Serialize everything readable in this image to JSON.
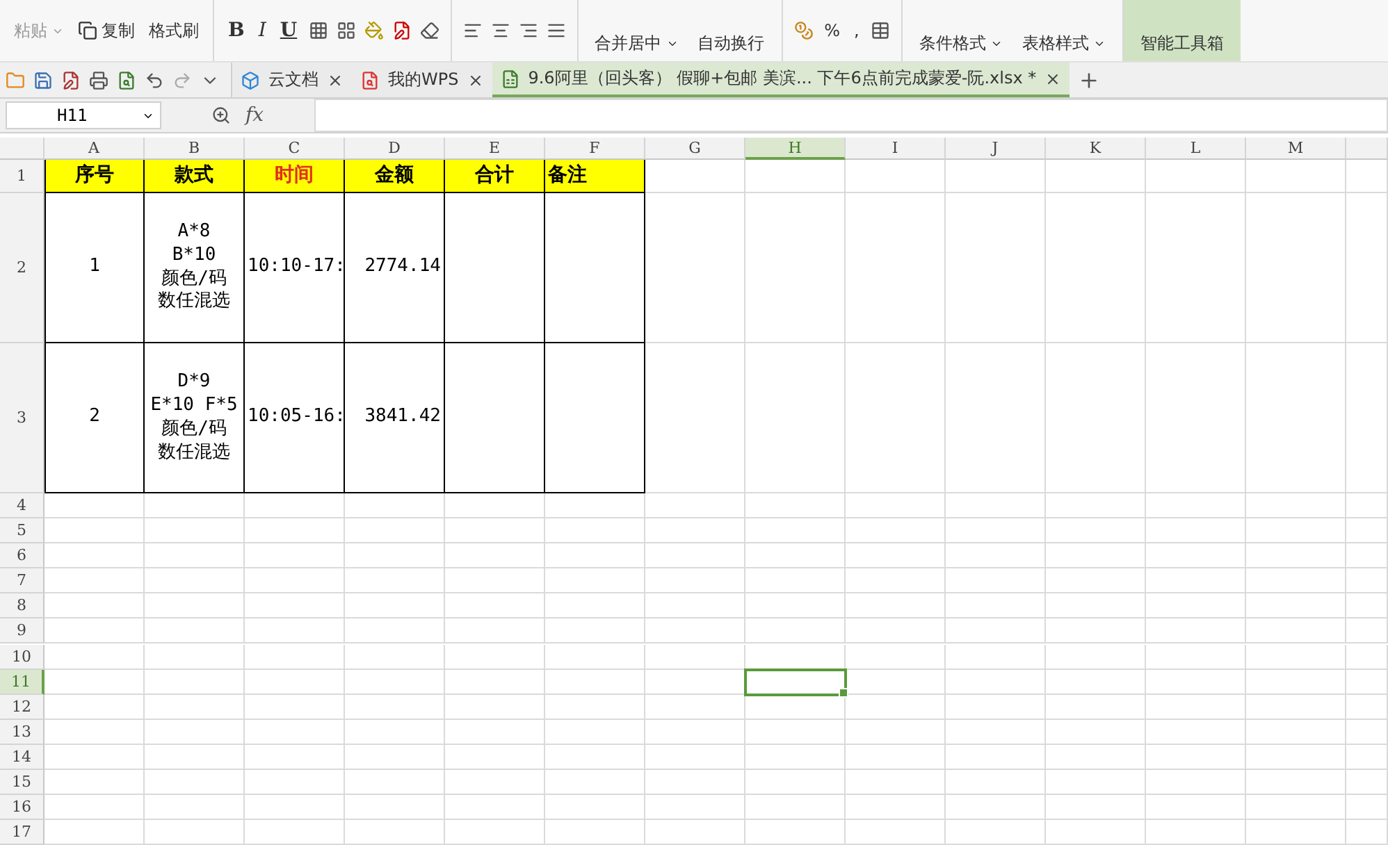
{
  "ribbon": {
    "groups": [
      {
        "kind": "clipboard",
        "labels": [
          "粘贴",
          "复制",
          "格式刷"
        ]
      },
      {
        "kind": "font",
        "labels": [
          "B",
          "I",
          "U"
        ]
      },
      {
        "kind": "align"
      },
      {
        "kind": "merge",
        "labels": [
          "合并居中",
          "自动换行"
        ]
      },
      {
        "kind": "number",
        "labels": [
          "%",
          ","
        ]
      },
      {
        "kind": "styles",
        "labels": [
          "条件格式",
          "表格样式"
        ]
      },
      {
        "kind": "tools",
        "labels": [
          "智能工具箱"
        ]
      }
    ]
  },
  "tabs": [
    {
      "kind": "cloud",
      "label": "云文档",
      "selected": false
    },
    {
      "kind": "wps",
      "label": "我的WPS",
      "selected": false
    },
    {
      "kind": "sheet",
      "label": "9.6阿里（回头客） 假聊+包邮 美滨... 下午6点前完成蒙爱-阮.xlsx *",
      "selected": true
    }
  ],
  "formula_bar": {
    "name_box": "H11",
    "fx": "fx"
  },
  "columns": [
    {
      "label": "A",
      "selected": false
    },
    {
      "label": "B",
      "selected": false
    },
    {
      "label": "C",
      "selected": false
    },
    {
      "label": "D",
      "selected": false
    },
    {
      "label": "E",
      "selected": false
    },
    {
      "label": "F",
      "selected": false
    },
    {
      "label": "G",
      "selected": false
    },
    {
      "label": "H",
      "selected": true
    },
    {
      "label": "I",
      "selected": false
    },
    {
      "label": "J",
      "selected": false
    },
    {
      "label": "K",
      "selected": false
    },
    {
      "label": "L",
      "selected": false
    },
    {
      "label": "M",
      "selected": false
    }
  ],
  "rows": [
    {
      "number": "1",
      "kind": "header",
      "selected": false,
      "cells": [
        {
          "text": "序号",
          "color": "#000000",
          "kind": "center"
        },
        {
          "text": "款式",
          "color": "#000000",
          "kind": "center"
        },
        {
          "text": "时间",
          "color": "#e0301e",
          "kind": "center"
        },
        {
          "text": "金额",
          "color": "#000000",
          "kind": "center"
        },
        {
          "text": "合计",
          "color": "#000000",
          "kind": "center"
        },
        {
          "text": "备注",
          "color": "#000000",
          "kind": "left"
        }
      ]
    },
    {
      "number": "2",
      "kind": "data",
      "selected": false,
      "cells": [
        {
          "text": "1",
          "kind": "center"
        },
        {
          "text": "A*8\nB*10\n颜色/码数任混选",
          "kind": "center"
        },
        {
          "text": "10:10-17:",
          "kind": "left"
        },
        {
          "text": "2774.14",
          "kind": "right"
        },
        {
          "kind": "empty"
        },
        {
          "kind": "empty"
        }
      ]
    },
    {
      "number": "3",
      "kind": "data",
      "selected": false,
      "cells": [
        {
          "text": "2",
          "kind": "center"
        },
        {
          "text": "D*9\nE*10 F*5\n颜色/码数任混选",
          "kind": "center"
        },
        {
          "text": "10:05-16:",
          "kind": "left"
        },
        {
          "text": "3841.42",
          "kind": "right"
        },
        {
          "kind": "empty"
        },
        {
          "kind": "empty"
        }
      ]
    },
    {
      "number": "4",
      "kind": "blank",
      "selected": false
    },
    {
      "number": "5",
      "kind": "blank",
      "selected": false
    },
    {
      "number": "6",
      "kind": "blank",
      "selected": false
    },
    {
      "number": "7",
      "kind": "blank",
      "selected": false
    },
    {
      "number": "8",
      "kind": "blank",
      "selected": false
    },
    {
      "number": "9",
      "kind": "blank",
      "selected": false
    },
    {
      "number": "10",
      "kind": "blank",
      "selected": false
    },
    {
      "number": "11",
      "kind": "blank",
      "selected": true
    },
    {
      "number": "12",
      "kind": "blank",
      "selected": false
    },
    {
      "number": "13",
      "kind": "blank",
      "selected": false
    },
    {
      "number": "14",
      "kind": "blank",
      "selected": false
    },
    {
      "number": "15",
      "kind": "blank",
      "selected": false
    },
    {
      "number": "16",
      "kind": "blank",
      "selected": false
    },
    {
      "number": "17",
      "kind": "blank",
      "selected": false
    }
  ]
}
